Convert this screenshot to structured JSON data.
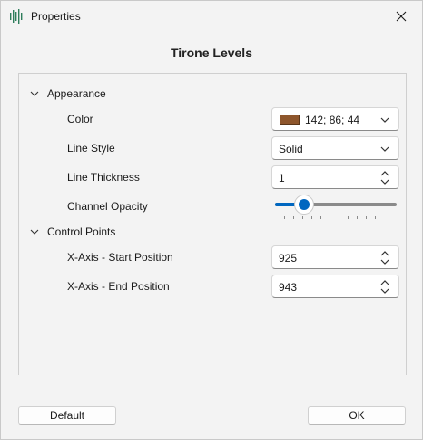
{
  "window": {
    "title": "Properties"
  },
  "heading": "Tirone Levels",
  "sections": {
    "appearance": {
      "label": "Appearance",
      "color": {
        "label": "Color",
        "value": "142; 86; 44",
        "swatch_hex": "#8e562c"
      },
      "line_style": {
        "label": "Line Style",
        "value": "Solid"
      },
      "line_thickness": {
        "label": "Line Thickness",
        "value": "1"
      },
      "channel_opacity": {
        "label": "Channel Opacity",
        "level_fraction": 0.24
      }
    },
    "control_points": {
      "label": "Control Points",
      "start": {
        "label": "X-Axis - Start Position",
        "value": "925"
      },
      "end": {
        "label": "X-Axis - End Position",
        "value": "943"
      }
    }
  },
  "buttons": {
    "default_label": "Default",
    "ok_label": "OK"
  },
  "colors": {
    "accent": "#0067c0",
    "background": "#f3f3f3"
  }
}
